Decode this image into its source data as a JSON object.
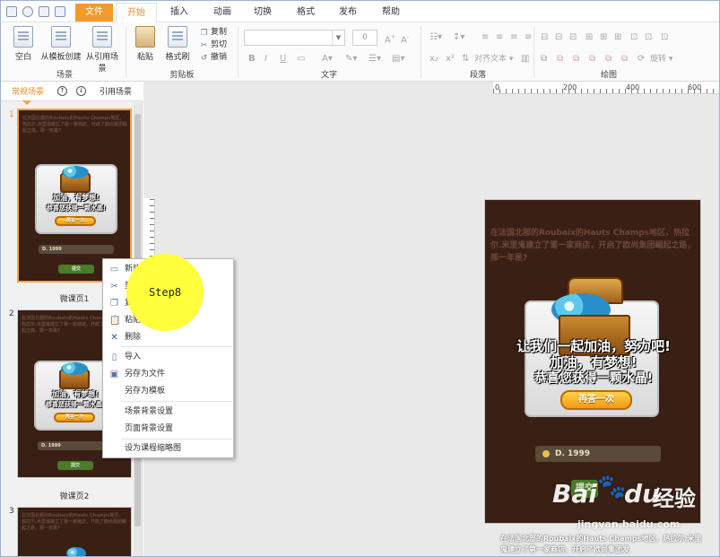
{
  "quick_access": [
    "save-icon",
    "open-icon",
    "undo-icon",
    "preview-icon"
  ],
  "tabs": [
    {
      "label": "文件"
    },
    {
      "label": "开始"
    },
    {
      "label": "插入"
    },
    {
      "label": "动画"
    },
    {
      "label": "切换"
    },
    {
      "label": "格式"
    },
    {
      "label": "发布"
    },
    {
      "label": "帮助"
    }
  ],
  "ribbon": {
    "scene_group": {
      "label": "场景",
      "blank": "空白",
      "from_template": "从模板创建",
      "from_reference": "从引用场景"
    },
    "clipboard_group": {
      "label": "剪贴板",
      "paste": "粘贴",
      "format_painter": "格式刷",
      "copy": "复制",
      "cut": "剪切",
      "undo": "撤销"
    },
    "text_group": {
      "label": "文字",
      "font_size": "0"
    },
    "paragraph_group": {
      "label": "段落",
      "align_text": "对齐文本"
    },
    "drawing_group": {
      "label": "绘图",
      "rotate": "旋转"
    }
  },
  "scene_panel": {
    "tab_normal": "常规场景",
    "tab_reference": "引用场景",
    "slides": [
      {
        "number": "1",
        "caption": "微课页1"
      },
      {
        "number": "2",
        "caption": "微课页2"
      },
      {
        "number": "3",
        "caption": ""
      }
    ]
  },
  "ruler": {
    "ticks": [
      "0",
      "200",
      "400",
      "600"
    ]
  },
  "scene": {
    "question": "在法国北部的Roubaix的Hauts Champs地区，热拉尔.米里鬼建立了第一家商店，开启了欧尚集团崛起之路，那一年是?",
    "line1": "让我们一起加油，努力吧!",
    "line2": "加油，有梦想!",
    "line3": "恭喜您获得一颗水晶!",
    "button": "再答一次",
    "answer": "D. 1999",
    "submit": "提交"
  },
  "context_menu": {
    "items": [
      {
        "label": "新建空白场景",
        "icon": "new-scene-icon"
      },
      {
        "label": "剪切",
        "icon": "cut-icon"
      },
      {
        "label": "复制",
        "icon": "copy-icon"
      },
      {
        "label": "粘贴",
        "icon": "paste-icon"
      },
      {
        "label": "删除",
        "icon": "delete-icon"
      },
      {
        "label": "导入",
        "icon": "import-icon"
      },
      {
        "label": "另存为文件",
        "icon": "save-as-file-icon"
      },
      {
        "label": "另存为模板",
        "icon": ""
      },
      {
        "label": "场景背景设置",
        "icon": ""
      },
      {
        "label": "页面背景设置",
        "icon": ""
      },
      {
        "label": "设为课程缩略图",
        "icon": ""
      }
    ]
  },
  "annotation": {
    "step_label": "Step8"
  },
  "overlay_caption": "在法国北部的Roubaix的Hauts Champs地区，热拉尔.米里鬼建立了第一家商店，开启了欧尚集团发",
  "watermark": {
    "brand": "Bai",
    "brand_suffix": "du",
    "cn": "经验",
    "url": "jingyan.baidu.com"
  },
  "colors": {
    "accent": "#f49a2c",
    "active_tab_text": "#f08a1c",
    "highlight": "#ffff3c",
    "scene_bg": "#3a1f14"
  }
}
